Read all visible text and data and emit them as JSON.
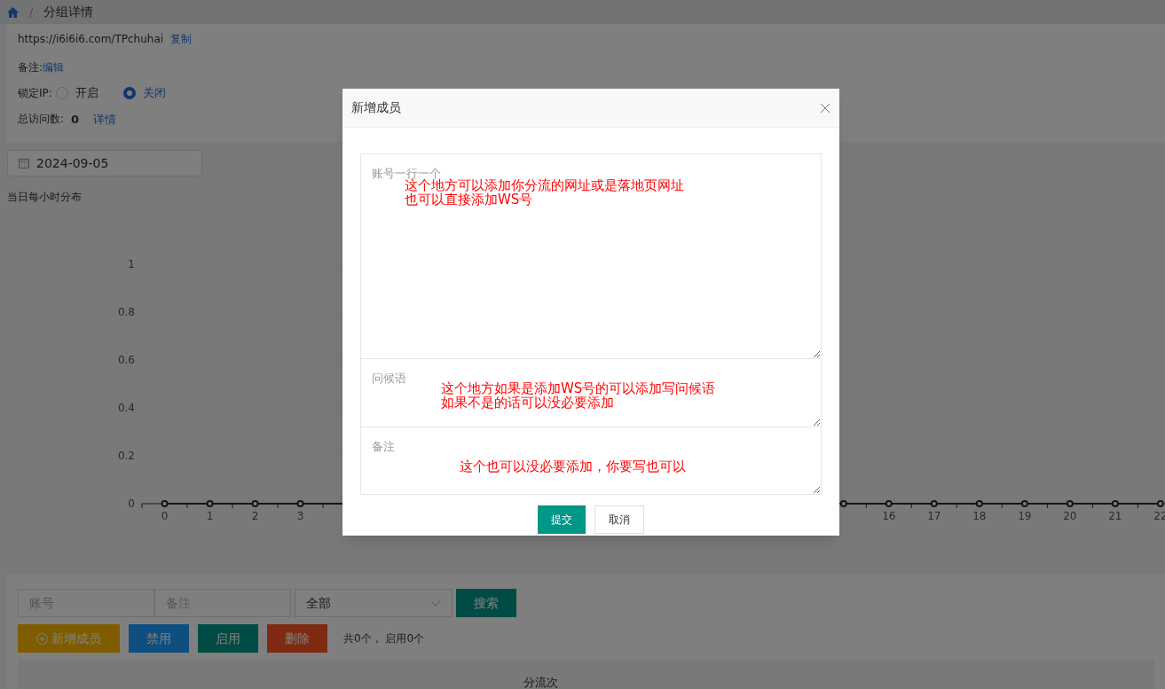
{
  "breadcrumb": {
    "separator": "/",
    "title": "分组详情"
  },
  "info": {
    "url": "https://i6i6i6.com/TPchuhai",
    "copy_link": "复制",
    "note_label": "备注:",
    "note_edit": "编辑",
    "lock_ip": {
      "label": "锁定IP:",
      "options": [
        {
          "label": "开启",
          "selected": false
        },
        {
          "label": "关闭",
          "selected": true
        }
      ]
    },
    "visits": {
      "label": "总访问数:",
      "value": "0",
      "link": "详情"
    }
  },
  "date_field": {
    "value": "2024-09-05"
  },
  "chart": {
    "title": "当日每小时分布",
    "chart_data": {
      "type": "line",
      "x": [
        0,
        1,
        2,
        3,
        15,
        16,
        17,
        18,
        19,
        20,
        21,
        22
      ],
      "series": [
        {
          "color": "#1f2d3d",
          "marker": "circle",
          "values": [
            0,
            0,
            0,
            0,
            0,
            0,
            0,
            0,
            0,
            0,
            0,
            0
          ]
        }
      ],
      "xticks": [
        0,
        1,
        2,
        3,
        16,
        17,
        18,
        19,
        20,
        21,
        22
      ],
      "xlim": [
        -0.5,
        22.1
      ],
      "ylim": [
        0,
        1
      ],
      "yticks": [
        0,
        0.2,
        0.4,
        0.6,
        0.8,
        1
      ]
    }
  },
  "filters": {
    "account": {
      "placeholder": "账号"
    },
    "note": {
      "placeholder": "备注"
    },
    "status": {
      "value": "全部"
    },
    "search_button": "搜索"
  },
  "actions": [
    {
      "kind": "add",
      "label": "新增成员"
    },
    {
      "kind": "disable",
      "label": "禁用"
    },
    {
      "kind": "enable",
      "label": "启用"
    },
    {
      "kind": "delete",
      "label": "删除"
    }
  ],
  "summary": "共0个， 启用0个",
  "table": {
    "columns": [
      "分流次"
    ]
  },
  "modal": {
    "title": "新增成员",
    "fields": [
      {
        "placeholder": "账号一行一个",
        "annotation": [
          "这个地方可以添加你分流的网址或是落地页网址",
          "也可以直接添加WS号"
        ]
      },
      {
        "placeholder": "问候语",
        "annotation": [
          "这个地方如果是添加WS号的可以添加写问候语",
          "如果不是的话可以没必要添加"
        ]
      },
      {
        "placeholder": "备注",
        "annotation": [
          "这个也可以没必要添加，你要写也可以"
        ]
      }
    ],
    "buttons": [
      {
        "kind": "primary",
        "label": "提交"
      },
      {
        "kind": "secondary",
        "label": "取消"
      }
    ]
  }
}
